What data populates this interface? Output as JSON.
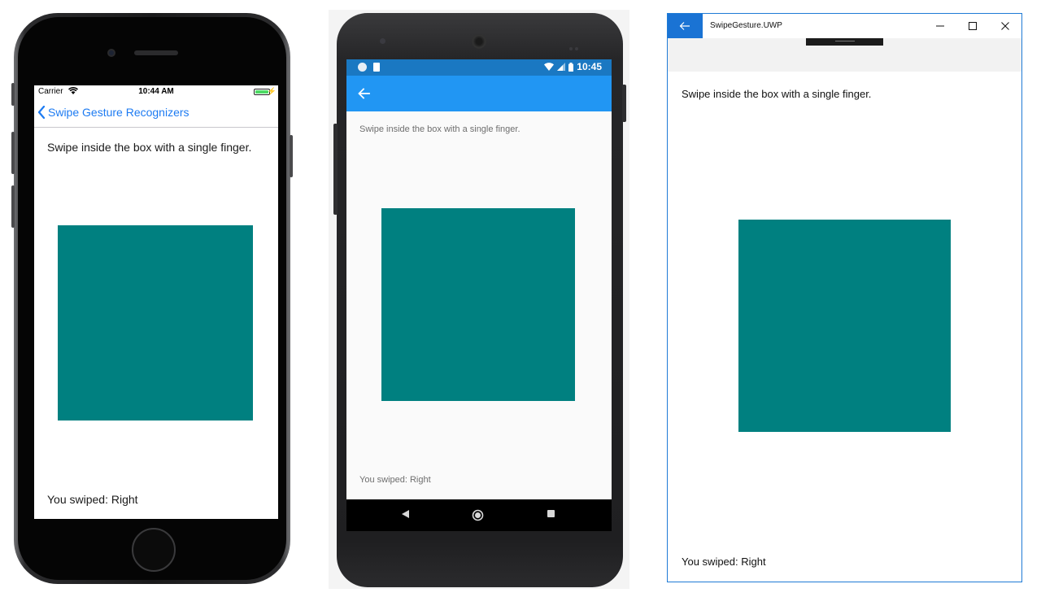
{
  "colors": {
    "swipe_box": "#008080",
    "ios_tint": "#1d7bf2",
    "android_appbar": "#2196f3",
    "android_statusbar": "#1a78c2",
    "uwp_accent": "#1a73d4"
  },
  "ios": {
    "status": {
      "carrier": "Carrier",
      "time": "10:44 AM",
      "battery_level": 1.0
    },
    "nav": {
      "back_label": "Swipe Gesture Recognizers",
      "back_icon": "chevron-left-icon"
    },
    "instruction": "Swipe inside the box with a single finger.",
    "result": "You swiped: Right"
  },
  "android": {
    "status": {
      "time": "10:45"
    },
    "appbar": {
      "back_icon": "arrow-left-icon"
    },
    "instruction": "Swipe inside the box with a single finger.",
    "result": "You swiped: Right",
    "navbar": [
      "back-triangle-icon",
      "home-circle-icon",
      "recents-square-icon"
    ]
  },
  "uwp": {
    "title": "SwipeGesture.UWP",
    "controls": [
      "minimize-icon",
      "maximize-icon",
      "close-icon"
    ],
    "instruction": "Swipe inside the box with a single finger.",
    "result": "You swiped: Right"
  }
}
